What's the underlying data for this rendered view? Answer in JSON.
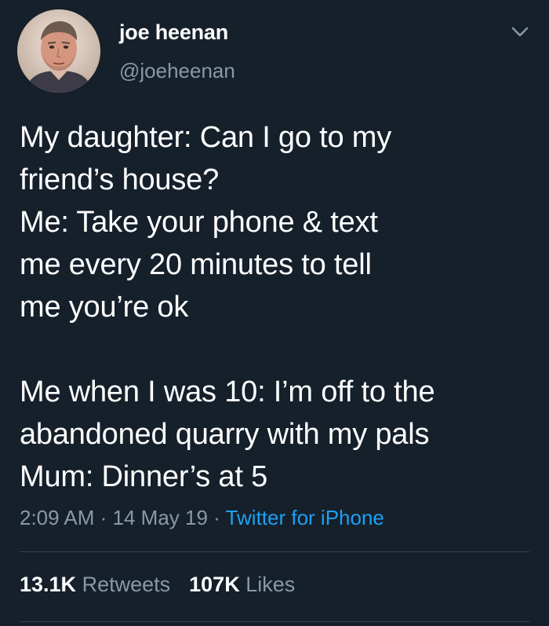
{
  "user": {
    "display_name": "joe heenan",
    "handle": "@joeheenan"
  },
  "tweet": {
    "text": "My daughter: Can I go to my\nfriend’s house?\nMe: Take your phone & text\nme every 20 minutes to tell\nme you’re ok\n\nMe when I was 10: I’m off to the\nabandoned quarry with my pals\nMum: Dinner’s at 5",
    "time": "2:09 AM",
    "separator": " · ",
    "date": "14 May 19",
    "source": "Twitter for iPhone"
  },
  "stats": {
    "retweets_count": "13.1K",
    "retweets_label": "Retweets",
    "likes_count": "107K",
    "likes_label": "Likes"
  },
  "icons": {
    "more": "chevron-down-icon",
    "avatar": "profile-photo"
  },
  "colors": {
    "background": "#15202b",
    "text": "#ffffff",
    "secondary_text": "#8899a6",
    "link": "#1da1f2",
    "divider": "#38444d"
  }
}
